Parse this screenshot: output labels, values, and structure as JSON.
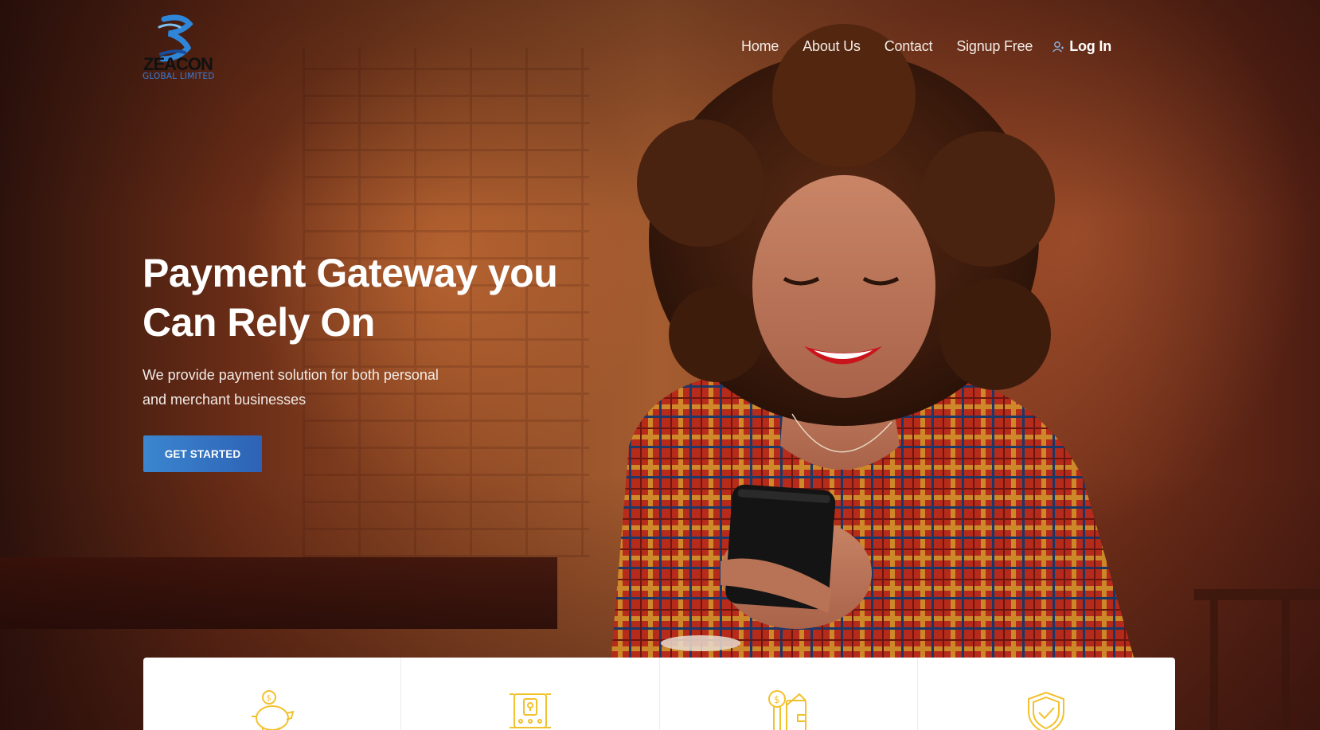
{
  "brand": {
    "logo_name": "ZEACON",
    "logo_subtitle": "GLOBAL LIMITED",
    "logo_icon": "wave-z-logo",
    "brand_color": "#3a7bd5"
  },
  "nav": {
    "items": [
      {
        "label": "Home"
      },
      {
        "label": "About Us"
      },
      {
        "label": "Contact"
      },
      {
        "label": "Signup Free"
      }
    ],
    "login_label": "Log In",
    "login_icon": "user-icon"
  },
  "hero": {
    "headline_line1": "Payment Gateway you",
    "headline_line2": "Can Rely On",
    "subline_line1": "We provide payment solution for both personal",
    "subline_line2": "and merchant businesses",
    "cta_label": "GET STARTED",
    "cta_color": "#3a7bd5"
  },
  "features": [
    {
      "icon": "piggy-bank-icon"
    },
    {
      "icon": "secure-device-icon"
    },
    {
      "icon": "coins-wallet-icon"
    },
    {
      "icon": "shield-check-icon"
    }
  ],
  "accent_icon_color": "#f2c12e"
}
